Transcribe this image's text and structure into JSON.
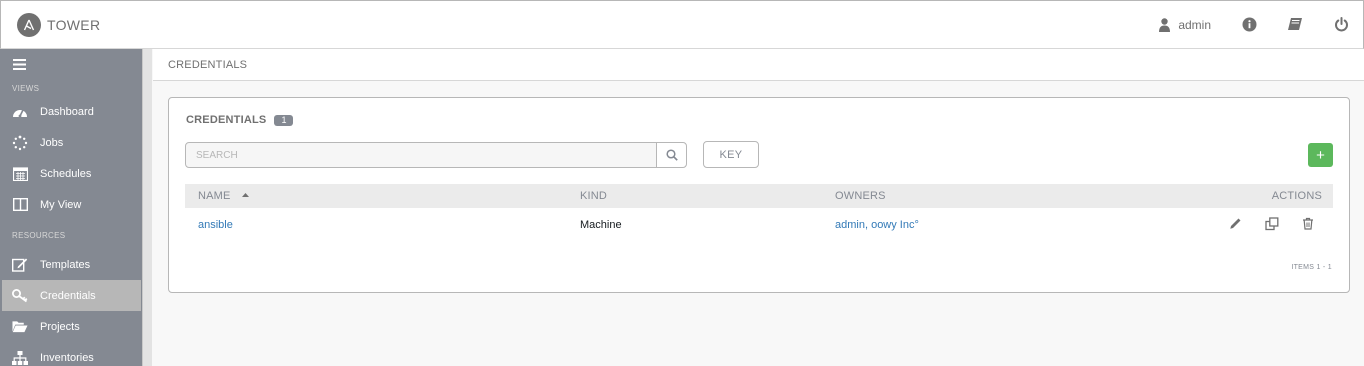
{
  "header": {
    "app_name": "TOWER",
    "user_name": "admin",
    "icons": [
      "logo-icon",
      "user-icon",
      "info-icon",
      "book-icon",
      "power-icon"
    ]
  },
  "sidebar": {
    "menu_icon": "hamburger-icon",
    "sections": {
      "views": "VIEWS",
      "resources": "RESOURCES"
    },
    "items": [
      {
        "label": "Dashboard",
        "icon": "dashboard-icon"
      },
      {
        "label": "Jobs",
        "icon": "spinner-icon"
      },
      {
        "label": "Schedules",
        "icon": "calendar-icon"
      },
      {
        "label": "My View",
        "icon": "columns-icon"
      },
      {
        "label": "Templates",
        "icon": "edit-icon"
      },
      {
        "label": "Credentials",
        "icon": "key-icon",
        "active": true
      },
      {
        "label": "Projects",
        "icon": "folder-open-icon"
      },
      {
        "label": "Inventories",
        "icon": "sitemap-icon"
      }
    ]
  },
  "breadcrumb": "CREDENTIALS",
  "panel": {
    "title": "CREDENTIALS",
    "count": "1",
    "search_placeholder": "SEARCH",
    "key_button": "KEY",
    "add_button": "+",
    "columns": {
      "name": "NAME",
      "kind": "KIND",
      "owners": "OWNERS",
      "actions": "ACTIONS"
    },
    "rows": [
      {
        "name": "ansible",
        "kind": "Machine",
        "owners": "admin, oowy Inc°"
      }
    ],
    "items_label": "ITEMS  1 - 1"
  },
  "colors": {
    "sidebar_bg": "#848992",
    "active_item_bg": "#b7b7b7",
    "link": "#337ab7",
    "add_button": "#5cb85c"
  }
}
